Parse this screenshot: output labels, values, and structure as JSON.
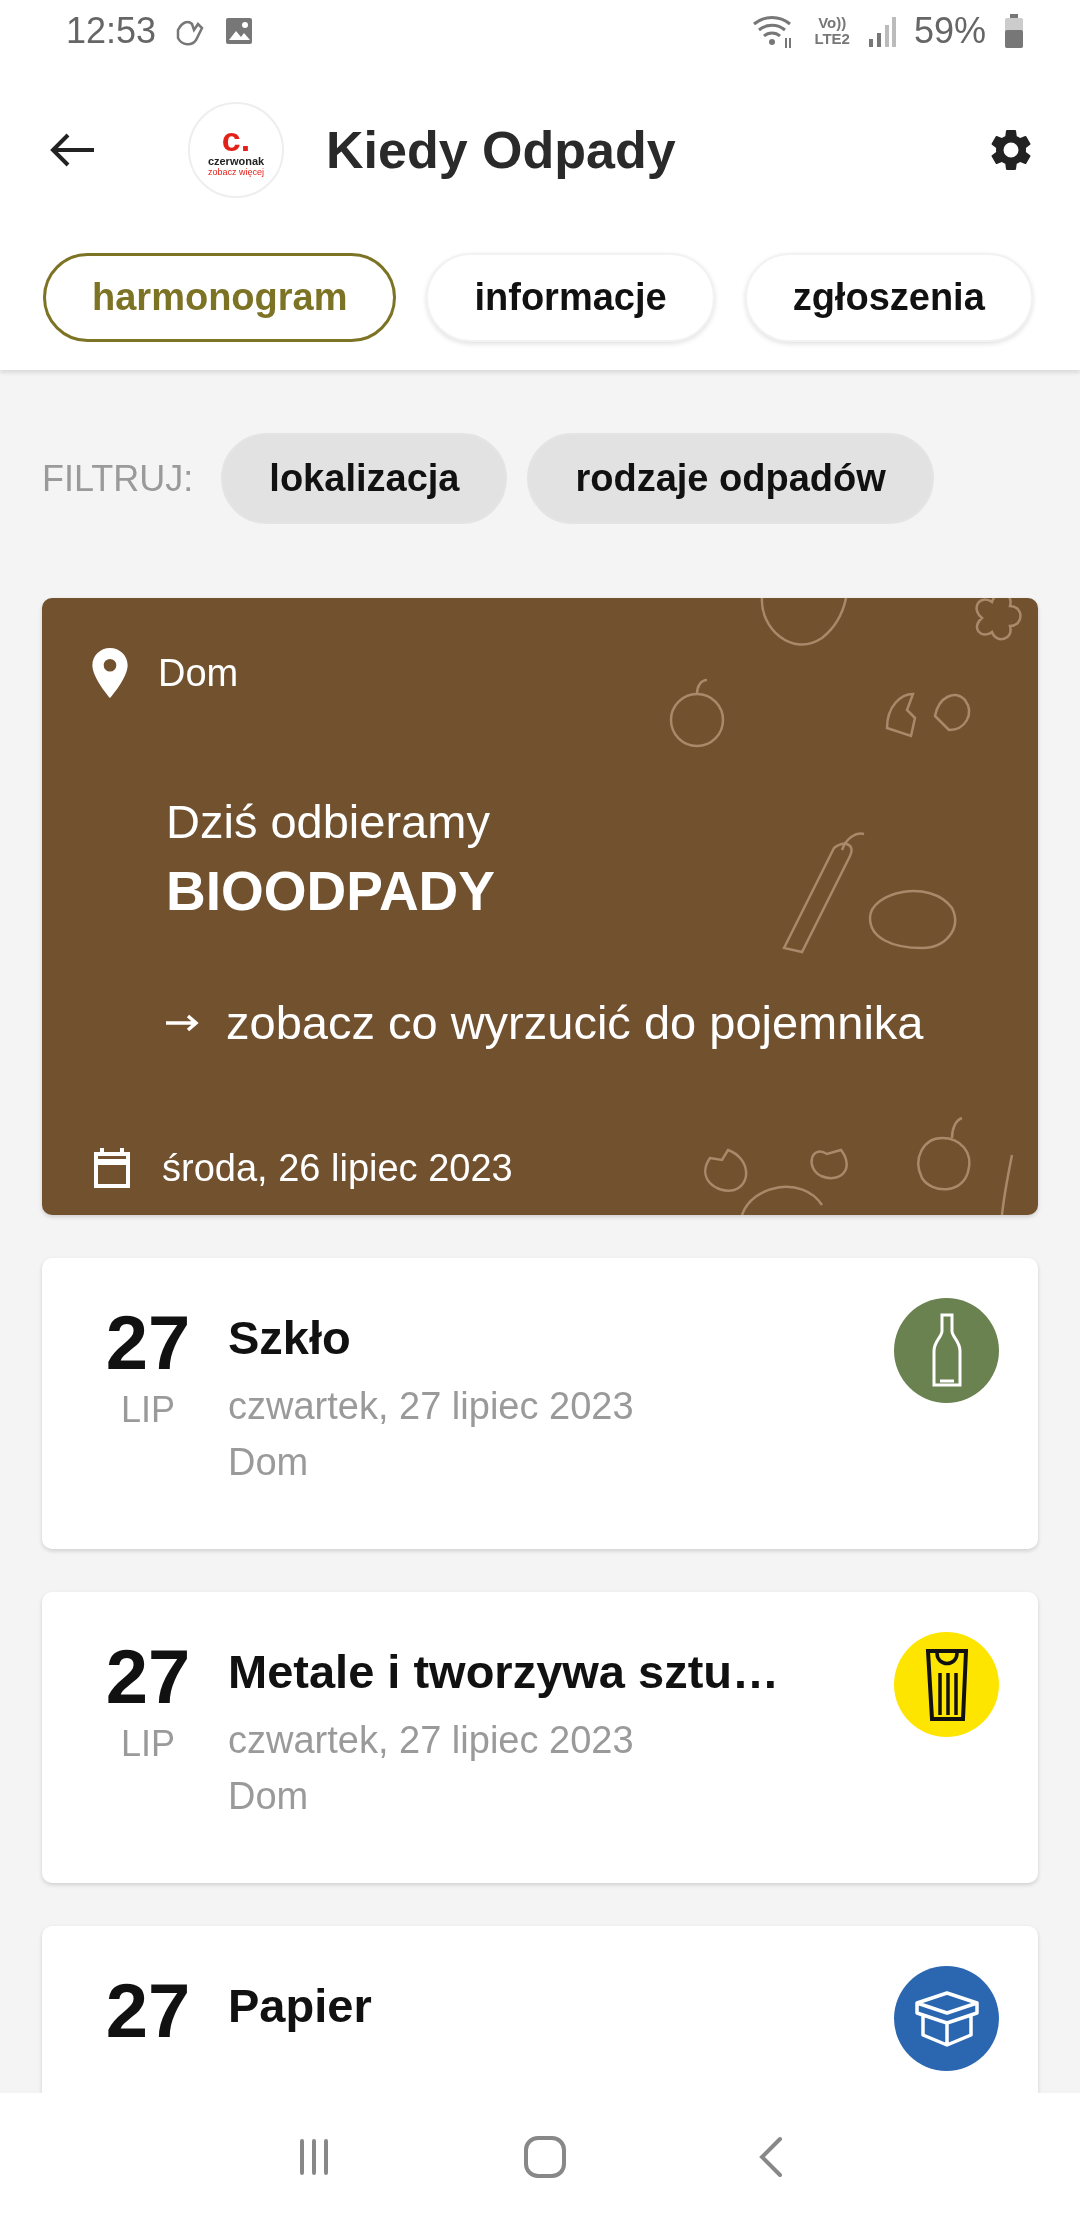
{
  "status_bar": {
    "time": "12:53",
    "volte": "Vo))",
    "network": "LTE2",
    "battery": "59%"
  },
  "header": {
    "logo": {
      "mark": "c.",
      "name": "czerwonak",
      "tagline": "zobacz więcej"
    },
    "title": "Kiedy Odpady"
  },
  "tabs": [
    {
      "label": "harmonogram",
      "selected": true
    },
    {
      "label": "informacje",
      "selected": false
    },
    {
      "label": "zgłoszenia",
      "selected": false
    }
  ],
  "filters": {
    "label": "FILTRUJ:",
    "chips": [
      "lokalizacja",
      "rodzaje odpadów"
    ]
  },
  "today": {
    "location": "Dom",
    "intro": "Dziś odbieramy",
    "waste_type": "BIOODPADY",
    "link": "zobacz co wyrzucić do pojemnika",
    "date": "środa, 26 lipiec 2023"
  },
  "schedule": [
    {
      "day": "27",
      "month": "LIP",
      "title": "Szkło",
      "date": "czwartek, 27 lipiec 2023",
      "location": "Dom",
      "kind": "glass",
      "color": "#6a8150"
    },
    {
      "day": "27",
      "month": "LIP",
      "title": "Metale i tworzywa sztu…",
      "date": "czwartek, 27 lipiec 2023",
      "location": "Dom",
      "kind": "metal",
      "color": "#fde500"
    },
    {
      "day": "27",
      "title": "Papier",
      "kind": "paper",
      "color": "#2b66b0"
    }
  ]
}
